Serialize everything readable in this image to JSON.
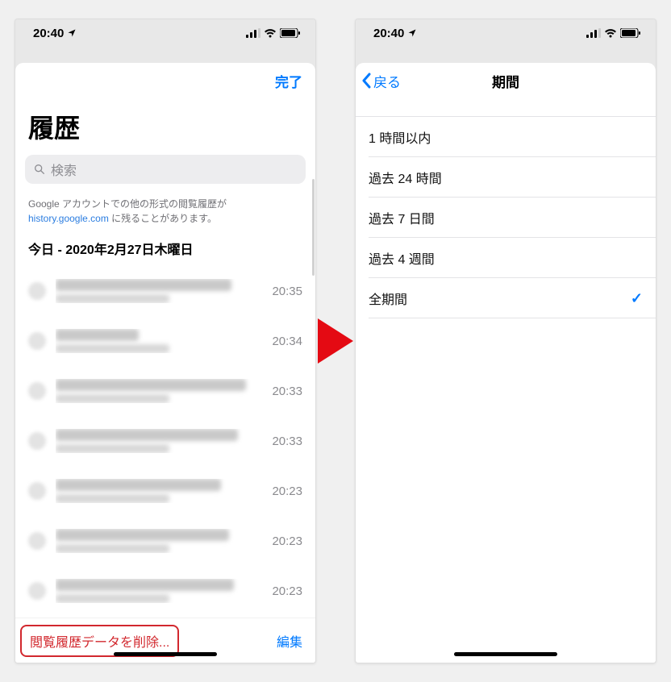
{
  "status": {
    "time": "20:40"
  },
  "left": {
    "done": "完了",
    "title": "履歴",
    "search_placeholder": "検索",
    "info_prefix": "Google アカウントでの他の形式の閲覧履歴が",
    "info_link": "history.google.com",
    "info_suffix": " に残ることがあります。",
    "date_header": "今日 - 2020年2月27日木曜日",
    "items": [
      {
        "time": "20:35"
      },
      {
        "time": "20:34"
      },
      {
        "time": "20:33"
      },
      {
        "time": "20:33"
      },
      {
        "time": "20:23"
      },
      {
        "time": "20:23"
      },
      {
        "time": "20:23"
      }
    ],
    "delete": "閲覧履歴データを削除...",
    "edit": "編集"
  },
  "right": {
    "back": "戻る",
    "title": "期間",
    "options": [
      {
        "label": "1 時間以内",
        "selected": false
      },
      {
        "label": "過去 24 時間",
        "selected": false
      },
      {
        "label": "過去 7 日間",
        "selected": false
      },
      {
        "label": "過去 4 週間",
        "selected": false
      },
      {
        "label": "全期間",
        "selected": true
      }
    ]
  }
}
